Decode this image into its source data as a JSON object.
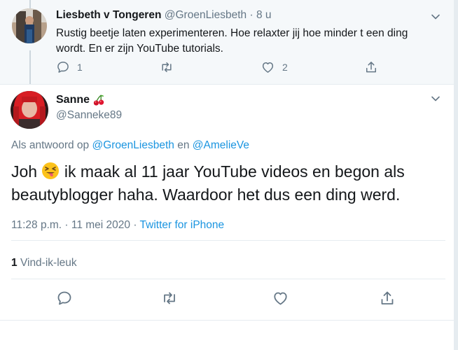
{
  "parent_tweet": {
    "name": "Liesbeth v Tongeren",
    "handle": "@GroenLiesbeth",
    "separator": "·",
    "time": "8 u",
    "text": "Rustig beetje laten experimenteren. Hoe relaxter jij hoe minder t een ding wordt. En er zijn YouTube tutorials.",
    "reply_count": "1",
    "like_count": "2"
  },
  "main_tweet": {
    "name": "Sanne",
    "name_emoji_icon": "cherries-icon",
    "handle": "@Sanneke89",
    "reply_prefix": "Als antwoord op",
    "reply_user_1": "@GroenLiesbeth",
    "reply_conjunction": "en",
    "reply_user_2": "@AmelieVe",
    "text_part1": "Joh",
    "text_emoji_icon": "squinting-tongue-face-icon",
    "text_part2": "ik maak al 11 jaar YouTube videos en begon als beautyblogger haha. Waardoor het dus een ding werd.",
    "timestamp": "11:28 p.m. · 11 mei 2020",
    "meta_separator": "·",
    "source": "Twitter for iPhone",
    "likes_count": "1",
    "likes_label": "Vind-ik-leuk"
  },
  "colors": {
    "link": "#1b95e0",
    "muted": "#657786",
    "parent_bg": "#f5f8fa",
    "divider": "#e6ecf0"
  }
}
